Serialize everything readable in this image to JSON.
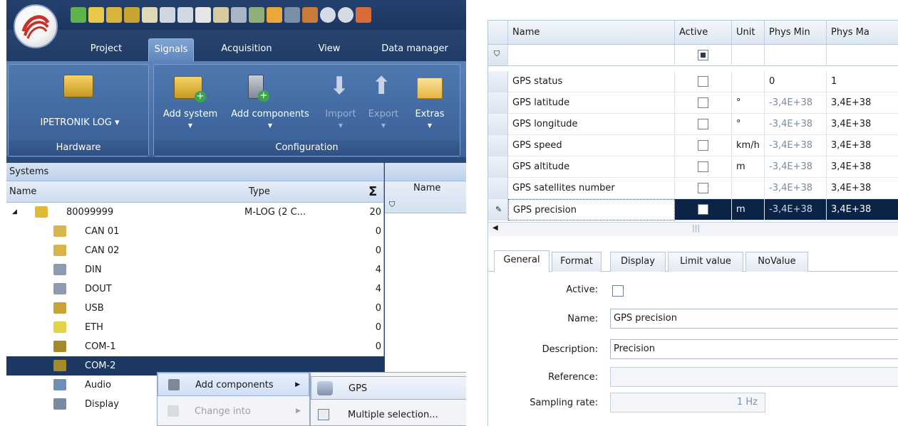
{
  "left": {
    "menu_tabs": [
      "Project",
      "Signals",
      "Acquisition",
      "View",
      "Data manager"
    ],
    "active_tab": "Signals",
    "ribbon": {
      "hardware_button": "IPETRONIK LOG",
      "hardware_group": "Hardware",
      "add_system": "Add system",
      "add_components": "Add components",
      "import": "Import",
      "export": "Export",
      "extras": "Extras",
      "configuration_group": "Configuration"
    },
    "systems_panel": {
      "title": "Systems",
      "col_name": "Name",
      "col_type": "Type",
      "sum_symbol": "Σ",
      "rows": [
        {
          "name": "80099999",
          "type": "M-LOG (2 C...",
          "count": "20",
          "icon": "system-icon"
        },
        {
          "name": "CAN 01",
          "type": "",
          "count": "0",
          "icon": "can-icon"
        },
        {
          "name": "CAN 02",
          "type": "",
          "count": "0",
          "icon": "can-icon"
        },
        {
          "name": "DIN",
          "type": "",
          "count": "4",
          "icon": "digital-in-icon"
        },
        {
          "name": "DOUT",
          "type": "",
          "count": "4",
          "icon": "digital-out-icon"
        },
        {
          "name": "USB",
          "type": "",
          "count": "0",
          "icon": "usb-icon"
        },
        {
          "name": "ETH",
          "type": "",
          "count": "0",
          "icon": "ethernet-icon"
        },
        {
          "name": "COM-1",
          "type": "",
          "count": "0",
          "icon": "serial-port-icon"
        },
        {
          "name": "COM-2",
          "type": "",
          "count": "",
          "icon": "serial-port-icon"
        },
        {
          "name": "Audio",
          "type": "",
          "count": "",
          "icon": "audio-icon"
        },
        {
          "name": "Display",
          "type": "",
          "count": "",
          "icon": "display-icon"
        }
      ]
    },
    "right_grid": {
      "col_name": "Name"
    },
    "context_menu": {
      "add_components": "Add components",
      "change_into": "Change into"
    },
    "submenu": {
      "gps": "GPS",
      "multiple": "Multiple selection..."
    }
  },
  "grid": {
    "columns": [
      "Name",
      "Active",
      "Unit",
      "Phys Min",
      "Phys Ma"
    ],
    "rows": [
      {
        "name": "GPS status",
        "unit": "",
        "min": "0",
        "max": "1",
        "min_dim": false
      },
      {
        "name": "GPS latitude",
        "unit": "°",
        "min": "-3,4E+38",
        "max": "3,4E+38",
        "min_dim": true
      },
      {
        "name": "GPS longitude",
        "unit": "°",
        "min": "-3,4E+38",
        "max": "3,4E+38",
        "min_dim": true
      },
      {
        "name": "GPS speed",
        "unit": "km/h",
        "min": "-3,4E+38",
        "max": "3,4E+38",
        "min_dim": true
      },
      {
        "name": "GPS altitude",
        "unit": "m",
        "min": "-3,4E+38",
        "max": "3,4E+38",
        "min_dim": true
      },
      {
        "name": "GPS satellites number",
        "unit": "",
        "min": "-3,4E+38",
        "max": "3,4E+38",
        "min_dim": true
      },
      {
        "name": "GPS precision",
        "unit": "m",
        "min": "-3,4E+38",
        "max": "3,4E+38",
        "min_dim": true
      }
    ],
    "scroll_grip": "|||"
  },
  "detail_tabs": [
    "General",
    "Format",
    "Display",
    "Limit value",
    "NoValue"
  ],
  "form": {
    "active_label": "Active:",
    "name_label": "Name:",
    "name_value": "GPS precision",
    "description_label": "Description:",
    "description_value": "Precision",
    "reference_label": "Reference:",
    "reference_value": "",
    "sampling_label": "Sampling rate:",
    "sampling_value": "1 Hz"
  }
}
